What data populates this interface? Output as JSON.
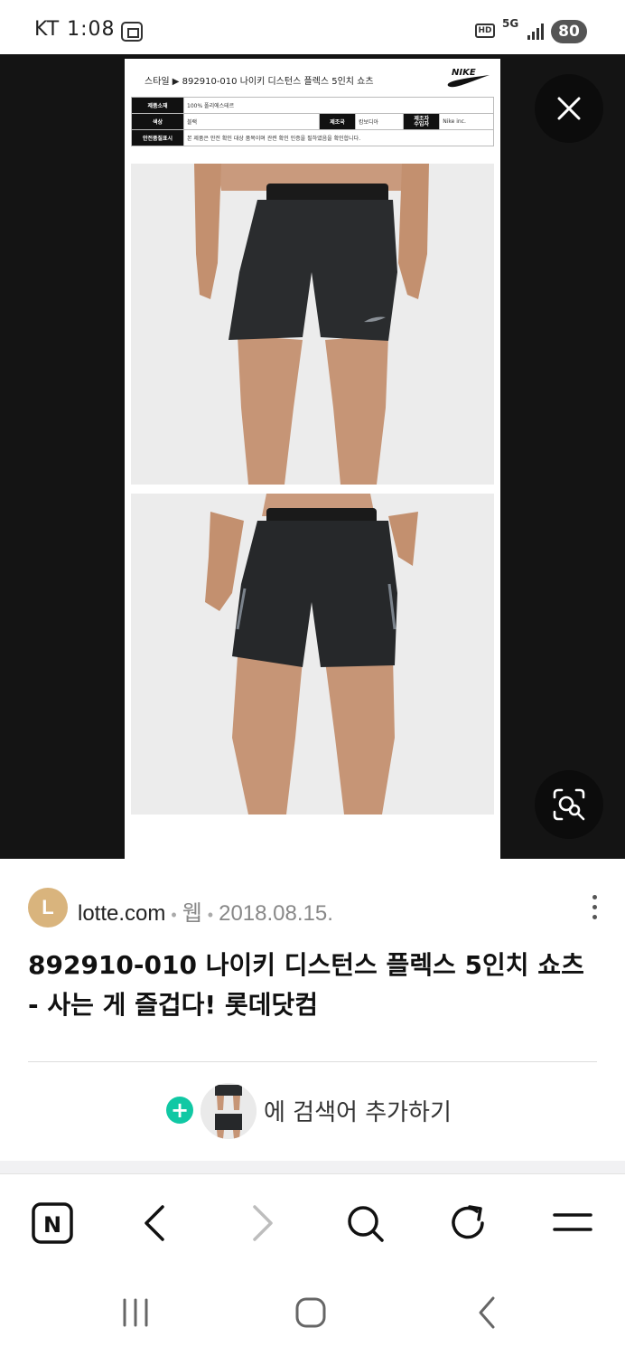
{
  "status_bar": {
    "carrier_time": "KT 1:08",
    "hd": "HD",
    "network": "5G",
    "battery": "80"
  },
  "viewer": {
    "spec_sheet": {
      "header": "스타일 ▶ 892910-010  나이키 디스턴스 플렉스 5인치 쇼츠",
      "brand_logo": "NIKE",
      "rows": [
        {
          "label": "제품소재",
          "value": "100% 폴리에스테르"
        },
        {
          "label": "색상",
          "value": "블랙",
          "label2": "제조국",
          "value2": "캄보디아",
          "label3": "제조자\n수입자",
          "value3": "Nike inc."
        },
        {
          "label": "안전품질표시",
          "value": "본 제품은 안전 확인 대상 품목이며 관련 확인 인증을 필하였음을 확인합니다."
        }
      ]
    },
    "close_icon": "close-icon",
    "lens_icon": "image-search-icon"
  },
  "result": {
    "avatar_letter": "L",
    "source": "lotte.com",
    "type": "웹",
    "date": "2018.08.15.",
    "title": "892910-010 나이키 디스턴스 플렉스 5인치 쇼츠 - 사는 게 즐겁다! 롯데닷컴",
    "add_keyword_label": "에 검색어 추가하기",
    "plus": "+"
  },
  "toolbar": {
    "items": [
      "naver-home-icon",
      "back-icon",
      "forward-icon",
      "search-icon",
      "refresh-icon",
      "menu-icon"
    ],
    "naver_letter": "N"
  },
  "colors": {
    "viewer_bg": "#141414",
    "accent_green": "#10c8a4",
    "avatar": "#d9b47d"
  }
}
